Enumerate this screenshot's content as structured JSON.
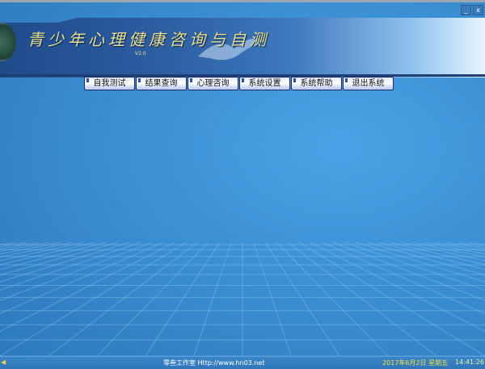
{
  "window": {
    "minimize_label": "_",
    "close_label": "x"
  },
  "header": {
    "title": "青少年心理健康咨询与自测",
    "version": "V2.0"
  },
  "nav": {
    "items": [
      {
        "label": "自我测试"
      },
      {
        "label": "结果查询"
      },
      {
        "label": "心理咨询"
      },
      {
        "label": "系统设置"
      },
      {
        "label": "系统帮助"
      },
      {
        "label": "退出系统"
      }
    ]
  },
  "status": {
    "speaker_icon": "◀",
    "studio": "零叁工作室 Http://www.hn03.net",
    "date": "2017年6月2日 星期五",
    "time": "14:41:26"
  },
  "colors": {
    "title": "#e8e08a",
    "date": "#f0e040",
    "background": "#3b8fd3"
  }
}
